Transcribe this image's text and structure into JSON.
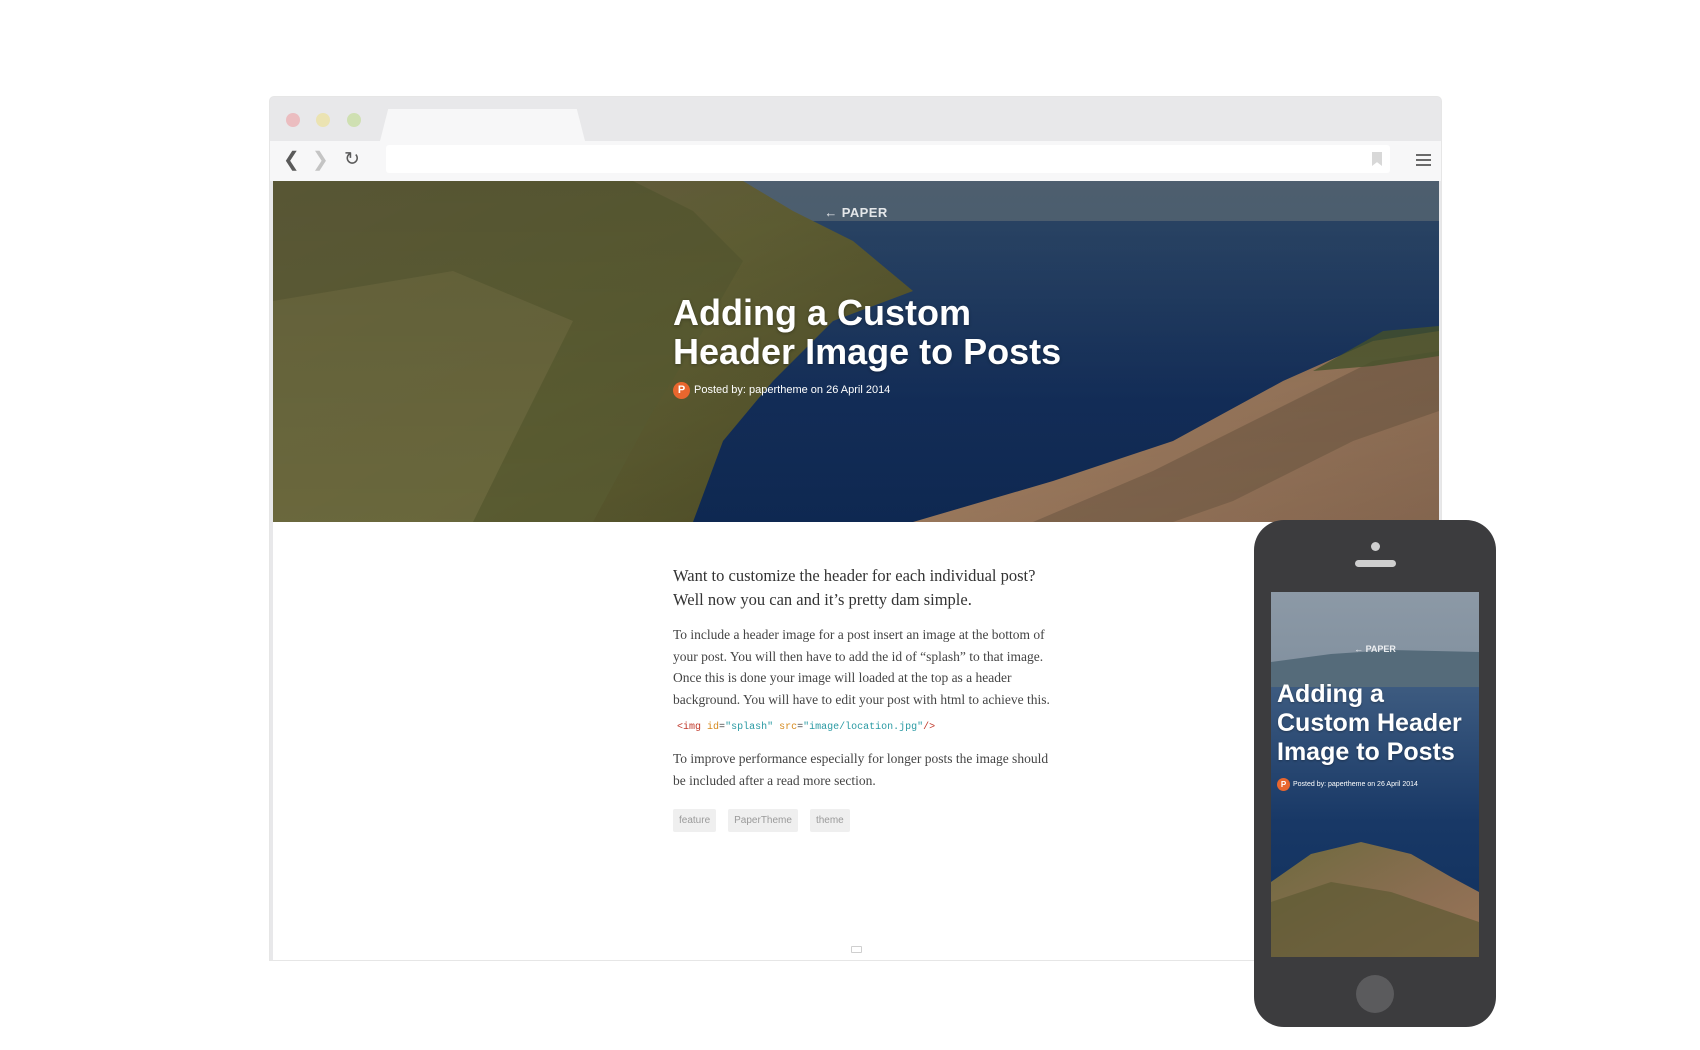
{
  "browser": {
    "url": ""
  },
  "site": {
    "back_link": "← PAPER"
  },
  "post": {
    "title": "Adding a Custom Header Image to Posts",
    "meta": "Posted by: papertheme on 26 April 2014",
    "author_initial": "P",
    "lead": "Want to customize the header for each individual post? Well now you can and it’s pretty dam simple.",
    "paragraph_1": "To include a header image for a post insert an image at the bottom of your post. You will then have to add the id of “splash” to that image. Once this is done your image will loaded at the top as a header background. You will have to edit your post with html to achieve this.",
    "code": {
      "tag_open": "<img",
      "attr_id": "id",
      "val_id": "\"splash\"",
      "attr_src": "src",
      "val_src": "\"image/location.jpg\"",
      "tag_close": "/>"
    },
    "paragraph_2": "To improve performance especially for longer posts the image should be included after a read more section.",
    "tags": [
      "feature",
      "PaperTheme",
      "theme"
    ]
  },
  "mobile": {
    "back_link": "← PAPER",
    "title": "Adding a Custom Header Image to Posts",
    "meta": "Posted by: papertheme on 26 April 2014",
    "author_initial": "P"
  },
  "colors": {
    "avatar": "#e8662e",
    "phone_body": "#3c3c3e",
    "browser_chrome": "#e8e8ea",
    "code_tag": "#c0392b",
    "code_attr": "#d68a1e",
    "code_value": "#2a9aa3"
  },
  "icons": [
    "back-arrow-icon",
    "forward-arrow-icon",
    "reload-icon",
    "bookmark-icon",
    "menu-icon"
  ]
}
